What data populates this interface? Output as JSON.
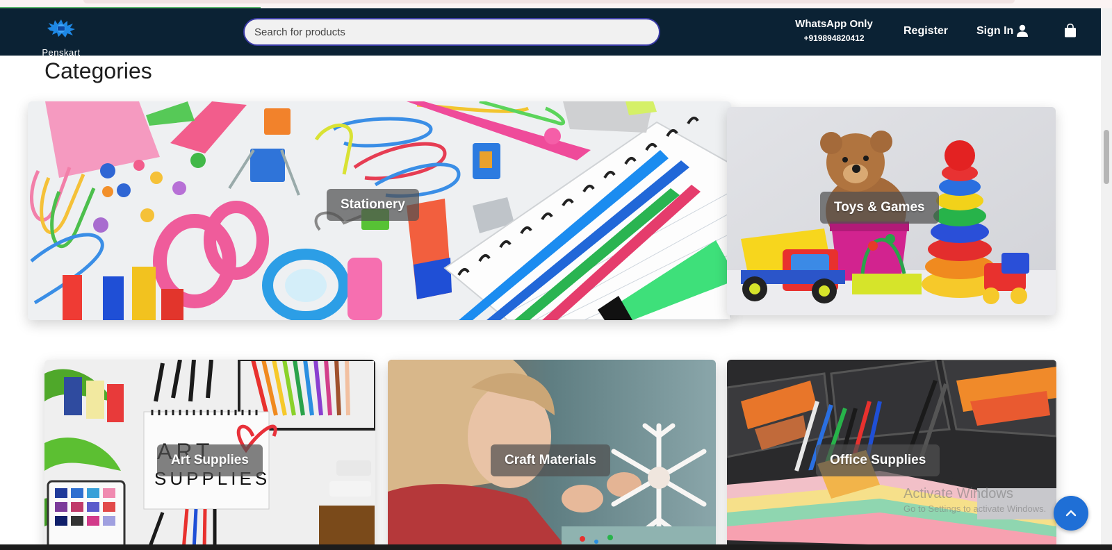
{
  "header": {
    "logo_text": "Penskart",
    "search_placeholder": "Search for products",
    "whatsapp_label": "WhatsApp Only",
    "whatsapp_number": "+919894820412",
    "register_label": "Register",
    "signin_label": "Sign In"
  },
  "main": {
    "section_title": "Categories",
    "categories": [
      {
        "label": "Stationery"
      },
      {
        "label": "Toys & Games"
      },
      {
        "label": "Art Supplies"
      },
      {
        "label": "Craft Materials"
      },
      {
        "label": "Office Supplies"
      }
    ]
  },
  "art_image_text": "ART SUPPLIES",
  "watermark": {
    "line1": "Activate Windows",
    "line2": "Go to Settings to activate Windows."
  },
  "colors": {
    "header_bg": "#0b2234",
    "accent_blue": "#1f6fd6",
    "search_border": "#3a3aa6"
  },
  "icons": {
    "user": "user-icon",
    "cart": "shopping-bag-icon",
    "scroll_top": "chevron-up-icon"
  }
}
